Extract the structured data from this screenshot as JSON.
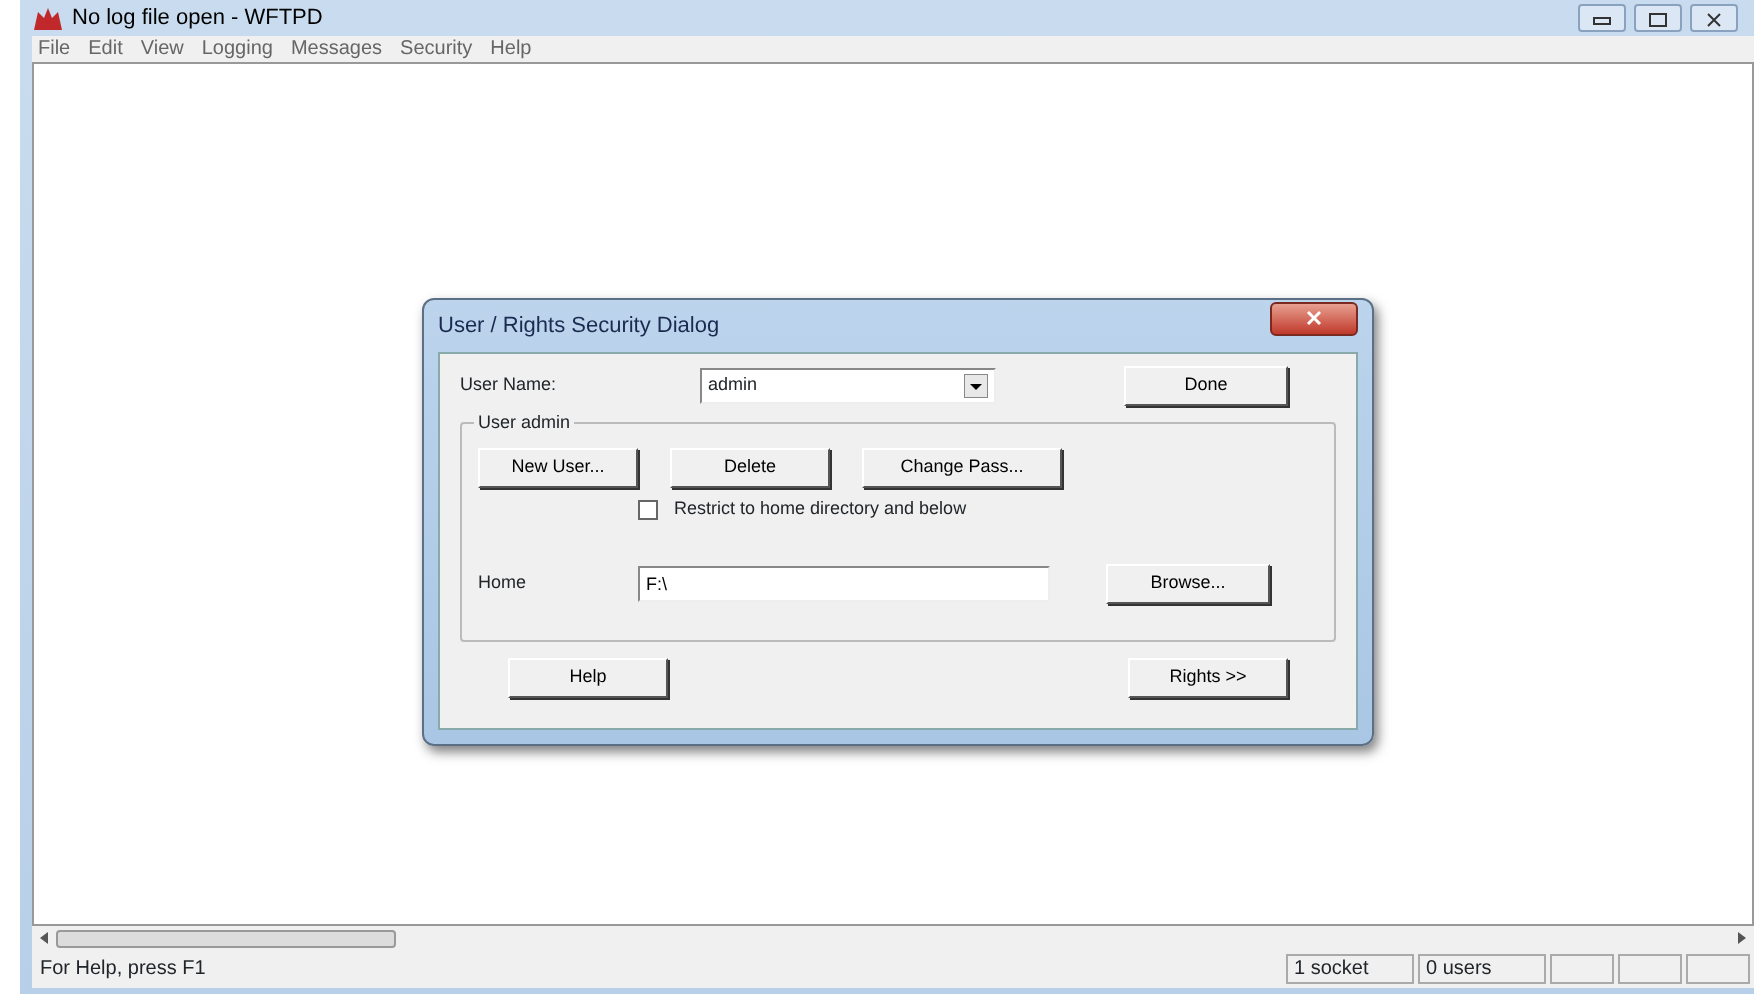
{
  "window": {
    "title": "No log file open - WFTPD"
  },
  "menu": [
    "File",
    "Edit",
    "View",
    "Logging",
    "Messages",
    "Security",
    "Help"
  ],
  "dialog": {
    "title": "User / Rights Security Dialog",
    "user_name_label": "User Name:",
    "user_name": "admin",
    "done": "Done",
    "group_label": "User admin",
    "group_buttons": [
      "New User...",
      "Delete",
      "Change Pass..."
    ],
    "restrict": {
      "label": "Restrict to home directory and below",
      "checked": false
    },
    "home_label": "Home",
    "home_value": "F:\\",
    "browse": "Browse...",
    "help": "Help",
    "rights": "Rights >>"
  },
  "status_bar": {
    "message": "For Help, press F1",
    "panes": [
      "1 socket",
      "0 users"
    ]
  }
}
